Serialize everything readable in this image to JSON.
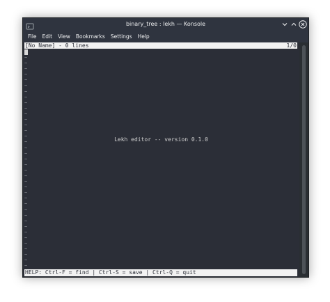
{
  "window": {
    "title": "binary_tree : lekh — Konsole"
  },
  "menu": {
    "items": [
      {
        "label": "File"
      },
      {
        "label": "Edit"
      },
      {
        "label": "View"
      },
      {
        "label": "Bookmarks"
      },
      {
        "label": "Settings"
      },
      {
        "label": "Help"
      }
    ]
  },
  "editor": {
    "status_left": "[No Name] - 0 lines",
    "status_right": "1/0",
    "welcome": "Lekh editor -- version 0.1.0",
    "help": "HELP: Ctrl-F = find | Ctrl-S = save | Ctrl-Q = quit",
    "empty_line_marker": "~"
  },
  "icons": {
    "app": "konsole-app-icon",
    "minimize": "chevron-down-icon",
    "maximize": "chevron-up-icon",
    "close": "close-icon"
  },
  "colors": {
    "terminal_bg": "#2b2e37",
    "titlebar_bg": "#2f343f",
    "statusline_bg": "#f2f2f2"
  }
}
